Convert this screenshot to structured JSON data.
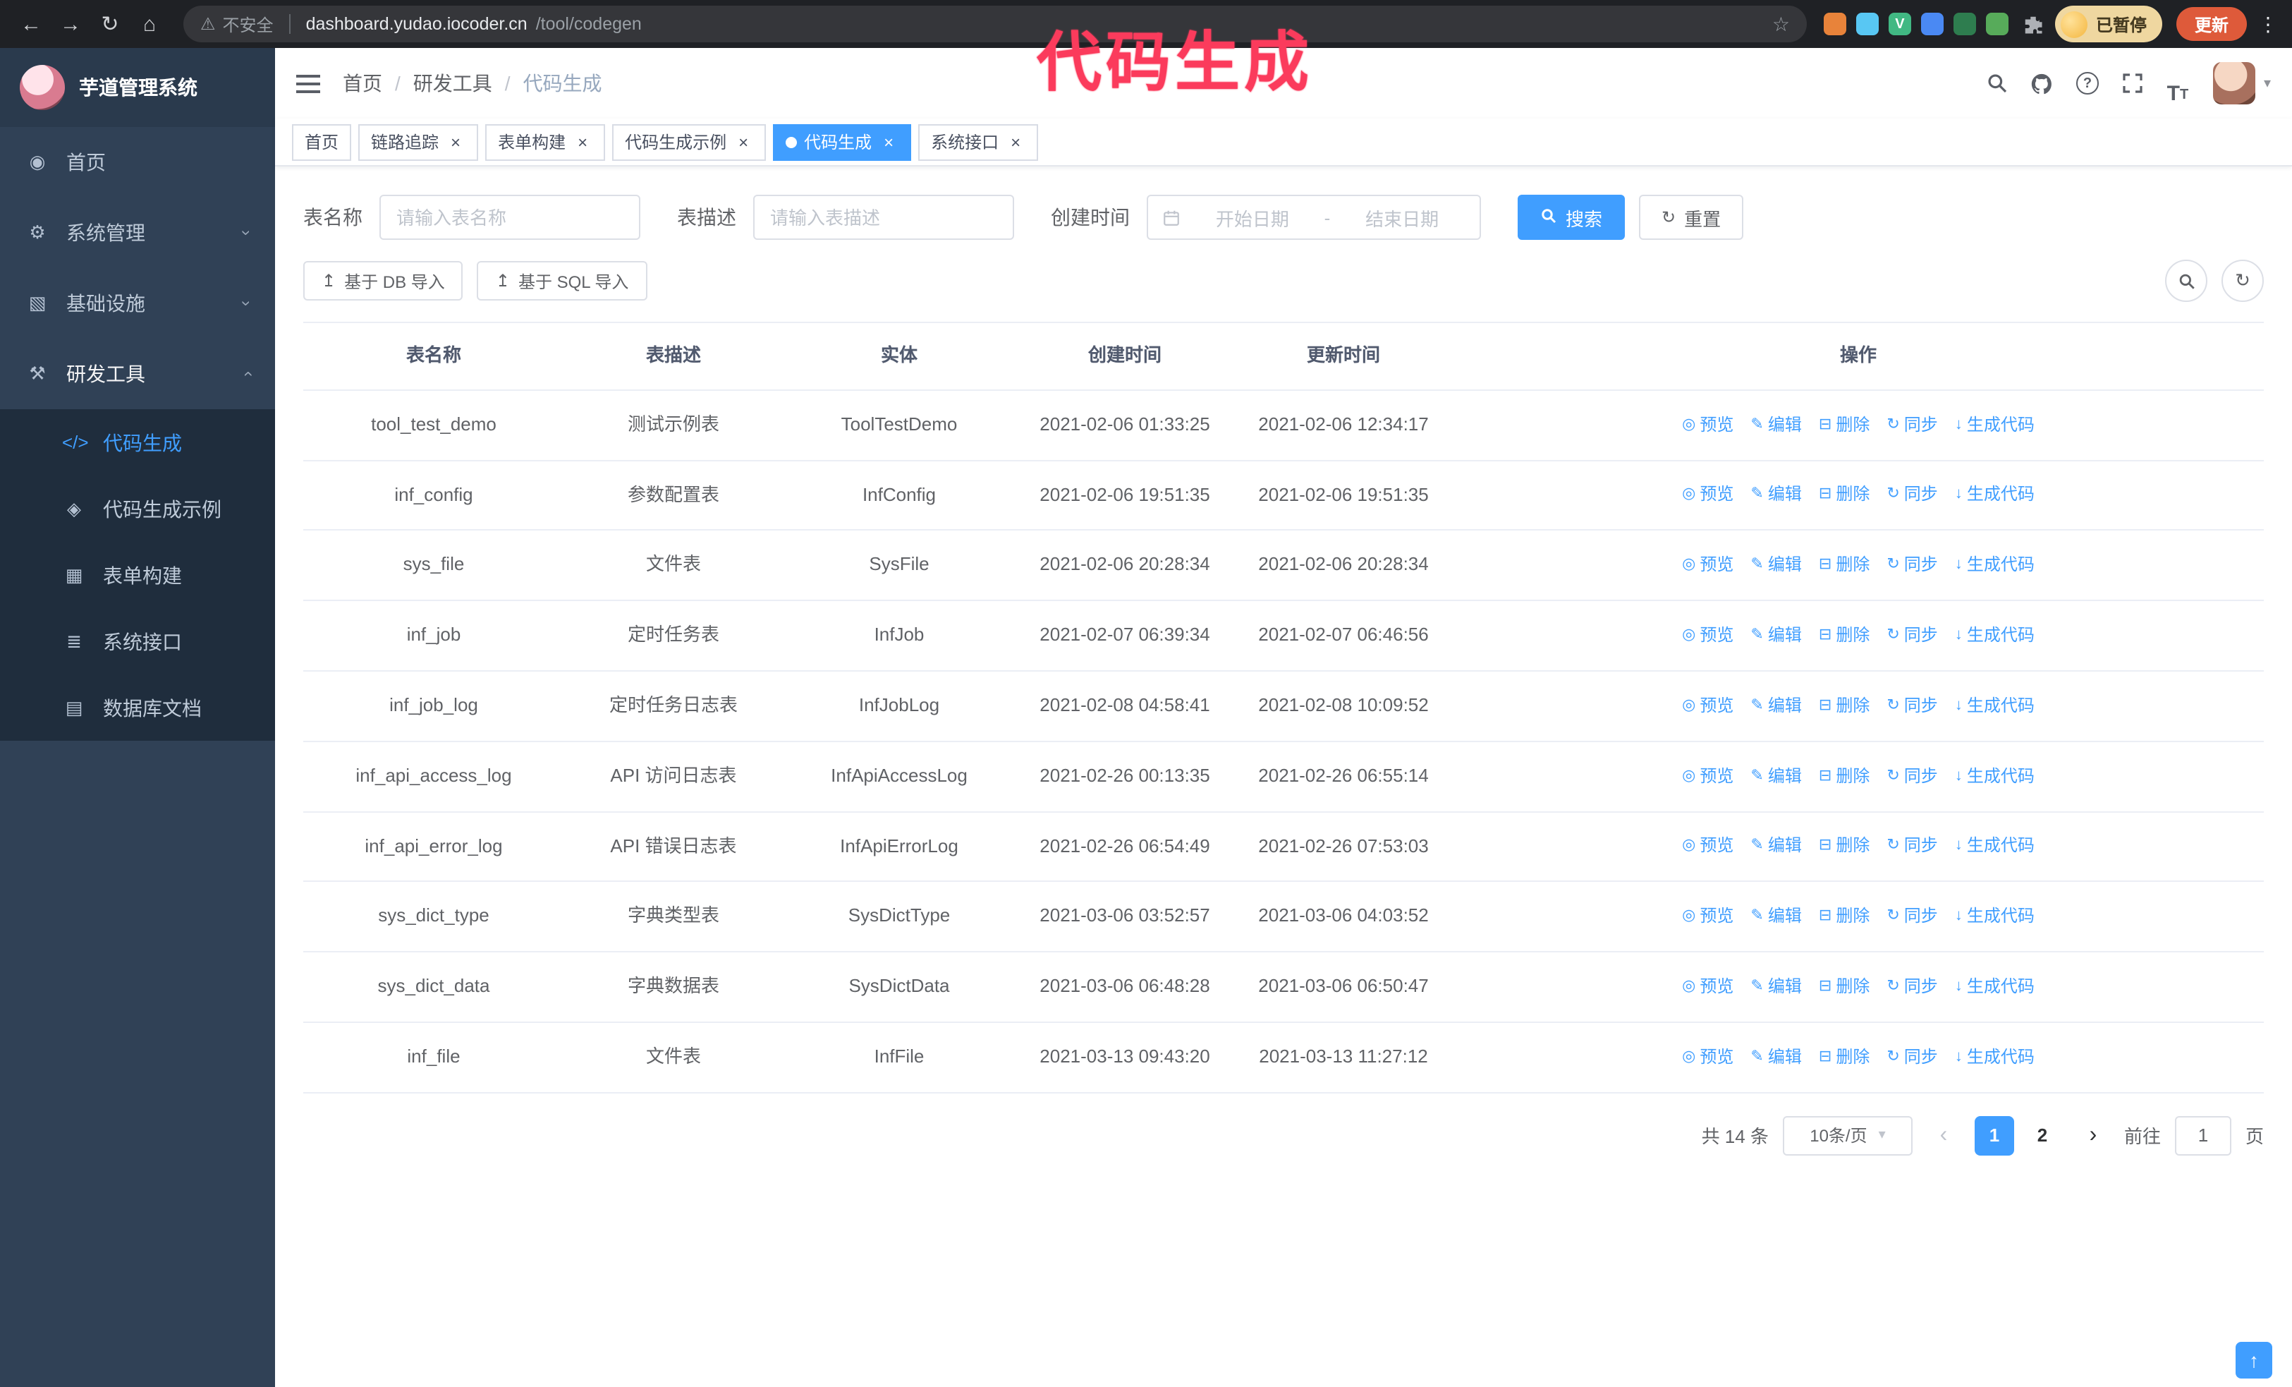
{
  "annotation": {
    "text": "代码生成"
  },
  "glyphs": {
    "caret_down": "▾",
    "chevron": "›",
    "close": "×",
    "help": "?",
    "font_large": "T",
    "font_small": "T"
  },
  "browser": {
    "back_icon": "←",
    "forward_icon": "→",
    "refresh_icon": "↻",
    "home_icon": "⌂",
    "security_warning_icon": "⚠",
    "security_label": "不安全",
    "url_host": "dashboard.yudao.iocoder.cn",
    "url_path": "/tool/codegen",
    "bookmark_icon": "☆",
    "extensions": [
      {
        "key": "orange",
        "color": "#e8833a",
        "glyph": ""
      },
      {
        "key": "lightblue",
        "color": "#58c7f3",
        "glyph": ""
      },
      {
        "key": "vue-devtools",
        "color": "#41b883",
        "glyph": "V"
      },
      {
        "key": "blue",
        "color": "#4a89f3",
        "glyph": ""
      },
      {
        "key": "dark-green",
        "color": "#2e7d4f",
        "glyph": ""
      },
      {
        "key": "green",
        "color": "#57ab5a",
        "glyph": ""
      }
    ],
    "profile_label": "已暂停",
    "update_label": "更新",
    "menu_icon": "⋮"
  },
  "sidebar": {
    "logo_title": "芋道管理系统",
    "items": [
      {
        "key": "home",
        "label": "首页",
        "icon": "◉"
      },
      {
        "key": "system-management",
        "label": "系统管理",
        "icon": "⚙",
        "group": true
      },
      {
        "key": "infrastructure",
        "label": "基础设施",
        "icon": "▧",
        "group": true
      },
      {
        "key": "dev-tools",
        "label": "研发工具",
        "icon": "⚒",
        "group": true,
        "expanded": true,
        "children": [
          {
            "key": "codegen",
            "label": "代码生成",
            "icon": "</>",
            "active": true
          },
          {
            "key": "codegen-example",
            "label": "代码生成示例",
            "icon": "◈"
          },
          {
            "key": "form-builder",
            "label": "表单构建",
            "icon": "▦"
          },
          {
            "key": "system-api",
            "label": "系统接口",
            "icon": "≣"
          },
          {
            "key": "db-doc",
            "label": "数据库文档",
            "icon": "▤"
          }
        ]
      }
    ]
  },
  "header": {
    "breadcrumb": [
      "首页",
      "研发工具",
      "代码生成"
    ]
  },
  "tabs": [
    {
      "key": "home",
      "label": "首页",
      "closable": false,
      "active": false
    },
    {
      "key": "tracer",
      "label": "链路追踪",
      "closable": true,
      "active": false
    },
    {
      "key": "form-builder",
      "label": "表单构建",
      "closable": true,
      "active": false
    },
    {
      "key": "codegen-example",
      "label": "代码生成示例",
      "closable": true,
      "active": false
    },
    {
      "key": "codegen",
      "label": "代码生成",
      "closable": true,
      "active": true
    },
    {
      "key": "system-api",
      "label": "系统接口",
      "closable": true,
      "active": false
    }
  ],
  "filters": {
    "table_name_label": "表名称",
    "table_name_placeholder": "请输入表名称",
    "table_desc_label": "表描述",
    "table_desc_placeholder": "请输入表描述",
    "create_time_label": "创建时间",
    "date_start_placeholder": "开始日期",
    "date_separator": "-",
    "date_end_placeholder": "结束日期",
    "search_label": "搜索",
    "reset_label": "重置",
    "reset_icon": "↻"
  },
  "toolbar": {
    "import_db_label": "基于 DB 导入",
    "import_sql_label": "基于 SQL 导入",
    "import_icon": "↥",
    "refresh_icon": "↻"
  },
  "table": {
    "columns": [
      "表名称",
      "表描述",
      "实体",
      "创建时间",
      "更新时间",
      "操作"
    ],
    "actions": [
      "预览",
      "编辑",
      "删除",
      "同步",
      "生成代码"
    ],
    "action_keys": [
      "preview",
      "edit",
      "delete",
      "sync",
      "generate-code"
    ],
    "action_icons": [
      "◎",
      "✎",
      "⊟",
      "↻",
      "↓"
    ],
    "rows": [
      {
        "name": "tool_test_demo",
        "desc": "测试示例表",
        "entity": "ToolTestDemo",
        "created": "2021-02-06 01:33:25",
        "updated": "2021-02-06 12:34:17"
      },
      {
        "name": "inf_config",
        "desc": "参数配置表",
        "entity": "InfConfig",
        "created": "2021-02-06 19:51:35",
        "updated": "2021-02-06 19:51:35"
      },
      {
        "name": "sys_file",
        "desc": "文件表",
        "entity": "SysFile",
        "created": "2021-02-06 20:28:34",
        "updated": "2021-02-06 20:28:34"
      },
      {
        "name": "inf_job",
        "desc": "定时任务表",
        "entity": "InfJob",
        "created": "2021-02-07 06:39:34",
        "updated": "2021-02-07 06:46:56"
      },
      {
        "name": "inf_job_log",
        "desc": "定时任务日志表",
        "entity": "InfJobLog",
        "created": "2021-02-08 04:58:41",
        "updated": "2021-02-08 10:09:52"
      },
      {
        "name": "inf_api_access_log",
        "desc": "API 访问日志表",
        "entity": "InfApiAccessLog",
        "created": "2021-02-26 00:13:35",
        "updated": "2021-02-26 06:55:14"
      },
      {
        "name": "inf_api_error_log",
        "desc": "API 错误日志表",
        "entity": "InfApiErrorLog",
        "created": "2021-02-26 06:54:49",
        "updated": "2021-02-26 07:53:03"
      },
      {
        "name": "sys_dict_type",
        "desc": "字典类型表",
        "entity": "SysDictType",
        "created": "2021-03-06 03:52:57",
        "updated": "2021-03-06 04:03:52"
      },
      {
        "name": "sys_dict_data",
        "desc": "字典数据表",
        "entity": "SysDictData",
        "created": "2021-03-06 06:48:28",
        "updated": "2021-03-06 06:50:47"
      },
      {
        "name": "inf_file",
        "desc": "文件表",
        "entity": "InfFile",
        "created": "2021-03-13 09:43:20",
        "updated": "2021-03-13 11:27:12"
      }
    ]
  },
  "pagination": {
    "total": "共 14 条",
    "page_size": "10条/页",
    "prev_icon": "‹",
    "next_icon": "›",
    "pages": [
      "1",
      "2"
    ],
    "current": "1",
    "jump_prefix": "前往",
    "jump_value": "1",
    "jump_suffix": "页"
  },
  "floating": {
    "icon": "↑"
  }
}
